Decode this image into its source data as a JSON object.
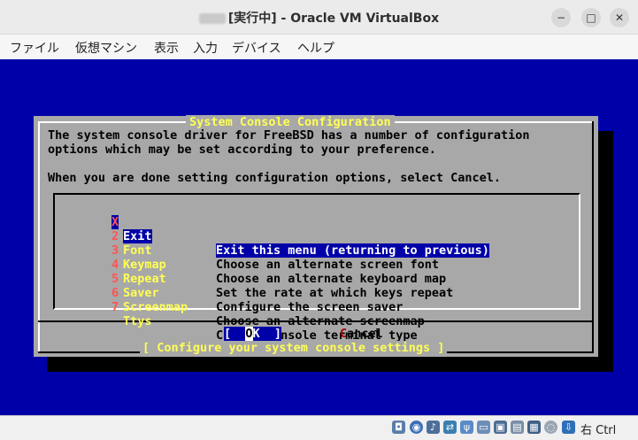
{
  "window": {
    "title": "[実行中] - Oracle VM VirtualBox",
    "minimize_icon": "−",
    "maximize_icon": "□",
    "close_icon": "✕"
  },
  "menubar": [
    "ファイル",
    "仮想マシン",
    "表示",
    "入力",
    "デバイス",
    "ヘルプ"
  ],
  "dialog": {
    "title": "System Console Configuration",
    "intro_line1": "The system console driver for FreeBSD has a number of configuration",
    "intro_line2": "options which may be set according to your preference.",
    "intro_line3": "When you are done setting configuration options, select Cancel.",
    "items": [
      {
        "num": "X",
        "label": "Exit",
        "desc": "Exit this menu (returning to previous)",
        "selected": true
      },
      {
        "num": "2",
        "label": "Font",
        "desc": "Choose an alternate screen font"
      },
      {
        "num": "3",
        "label": "Keymap",
        "desc": "Choose an alternate keyboard map"
      },
      {
        "num": "4",
        "label": "Repeat",
        "desc": "Set the rate at which keys repeat"
      },
      {
        "num": "5",
        "label": "Saver",
        "desc": "Configure the screen saver"
      },
      {
        "num": "6",
        "label": "Screenmap",
        "desc": "Choose an alternate screenmap"
      },
      {
        "num": "7",
        "label": "Ttys",
        "desc": "Choose console terminal type"
      }
    ],
    "ok_left": "[  ",
    "ok_hot": "O",
    "ok_right": "K  ]",
    "cancel_hot": "C",
    "cancel_rest": "ancel",
    "hint": "[ Configure your system console settings ]"
  },
  "statusbar": {
    "host_key": "右 Ctrl",
    "icons": [
      "hard-disk-icon",
      "optical-drive-icon",
      "audio-icon",
      "network-icon",
      "usb-icon",
      "shared-folder-icon",
      "display-icon",
      "recording-icon",
      "capture-icon",
      "mouse-integration-icon",
      "host-key-icon"
    ]
  },
  "colors": {
    "vm_background": "#0000a8",
    "dialog_background": "#a8a8a8",
    "title_yellow": "#ffff54",
    "hotkey_red": "#ff5454"
  }
}
